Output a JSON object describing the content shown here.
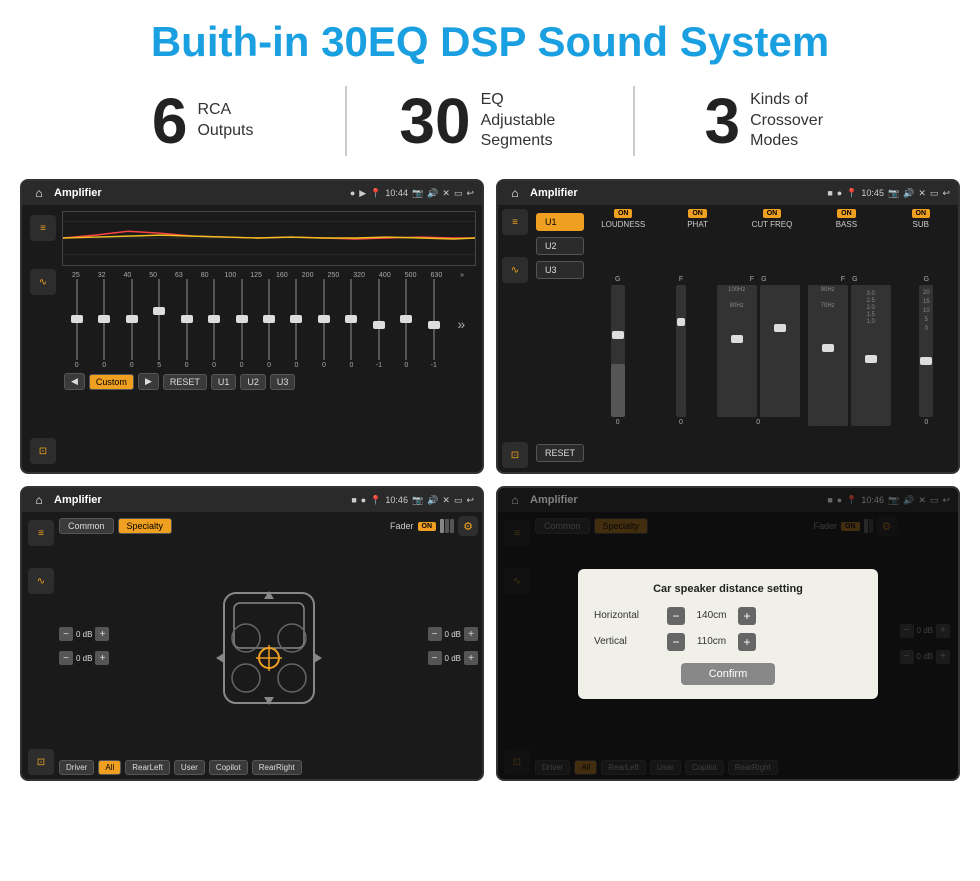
{
  "page": {
    "title": "Buith-in 30EQ DSP Sound System"
  },
  "stats": [
    {
      "number": "6",
      "text_line1": "RCA",
      "text_line2": "Outputs"
    },
    {
      "number": "30",
      "text_line1": "EQ Adjustable",
      "text_line2": "Segments"
    },
    {
      "number": "3",
      "text_line1": "Kinds of",
      "text_line2": "Crossover Modes"
    }
  ],
  "screen1": {
    "status": {
      "title": "Amplifier",
      "time": "10:44"
    },
    "freq_labels": [
      "25",
      "32",
      "40",
      "50",
      "63",
      "80",
      "100",
      "125",
      "160",
      "200",
      "250",
      "320",
      "400",
      "500",
      "630"
    ],
    "slider_values": [
      "0",
      "0",
      "0",
      "5",
      "0",
      "0",
      "0",
      "0",
      "0",
      "0",
      "0",
      "-1",
      "0",
      "-1"
    ],
    "preset_buttons": [
      "Custom",
      "RESET",
      "U1",
      "U2",
      "U3"
    ]
  },
  "screen2": {
    "status": {
      "title": "Amplifier",
      "time": "10:45"
    },
    "presets": [
      "U1",
      "U2",
      "U3"
    ],
    "controls": [
      {
        "label": "LOUDNESS",
        "on": true
      },
      {
        "label": "PHAT",
        "on": true
      },
      {
        "label": "CUT FREQ",
        "on": true
      },
      {
        "label": "BASS",
        "on": true
      },
      {
        "label": "SUB",
        "on": true
      }
    ],
    "reset_label": "RESET"
  },
  "screen3": {
    "status": {
      "title": "Amplifier",
      "time": "10:46"
    },
    "tabs": [
      "Common",
      "Specialty"
    ],
    "active_tab": "Specialty",
    "fader_label": "Fader",
    "fader_on": "ON",
    "db_values": [
      "0 dB",
      "0 dB",
      "0 dB",
      "0 dB"
    ],
    "buttons": [
      "Driver",
      "RearLeft",
      "All",
      "User",
      "Copilot",
      "RearRight"
    ]
  },
  "screen4": {
    "status": {
      "title": "Amplifier",
      "time": "10:46"
    },
    "tabs": [
      "Common",
      "Specialty"
    ],
    "fader_label": "Fader",
    "fader_on": "ON",
    "dialog": {
      "title": "Car speaker distance setting",
      "horizontal_label": "Horizontal",
      "horizontal_value": "140cm",
      "vertical_label": "Vertical",
      "vertical_value": "110cm",
      "confirm_label": "Confirm"
    },
    "buttons": [
      "Driver",
      "RearLeft",
      "All",
      "User",
      "Copilot",
      "RearRight"
    ],
    "db_values": [
      "0 dB",
      "0 dB"
    ]
  }
}
